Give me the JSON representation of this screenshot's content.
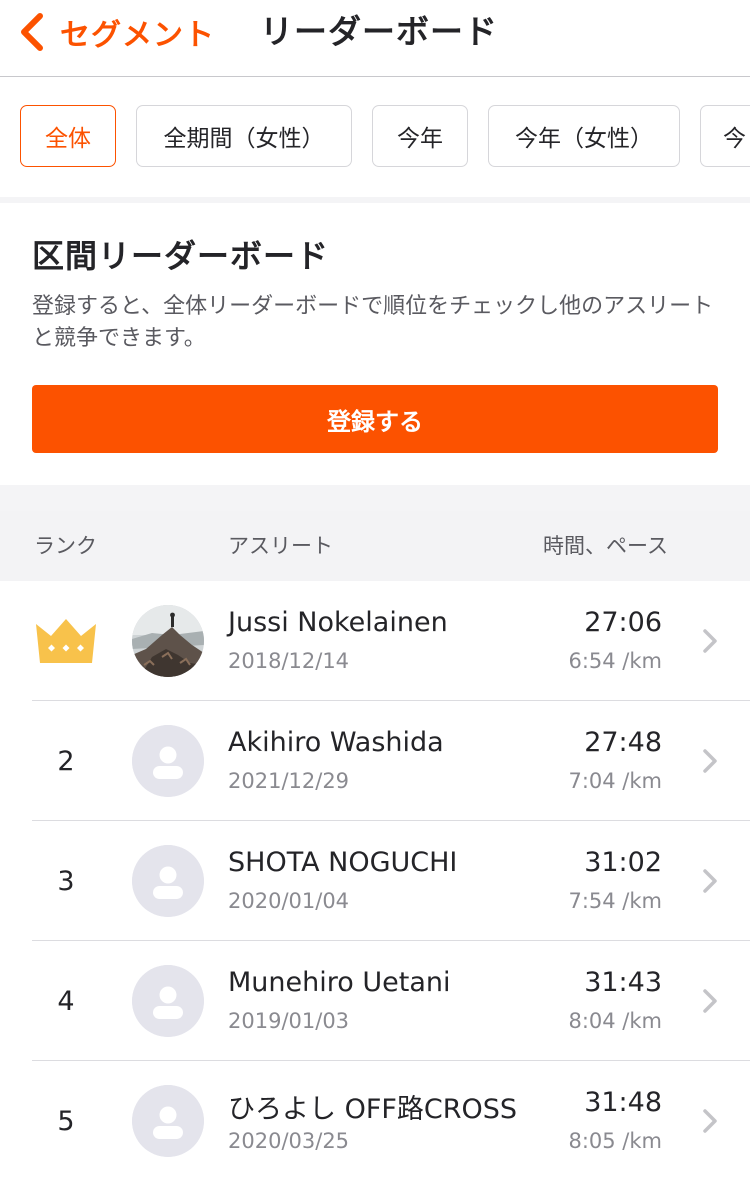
{
  "nav": {
    "back_label": "セグメント",
    "title": "リーダーボード"
  },
  "filters": [
    {
      "label": "全体",
      "active": true
    },
    {
      "label": "全期間（女性）",
      "active": false
    },
    {
      "label": "今年",
      "active": false
    },
    {
      "label": "今年（女性）",
      "active": false
    },
    {
      "label": "今",
      "active": false
    }
  ],
  "card": {
    "title": "区間リーダーボード",
    "description": "登録すると、全体リーダーボードで順位をチェックし他のアスリートと競争できます。",
    "button_label": "登録する"
  },
  "table": {
    "headers": {
      "rank": "ランク",
      "athlete": "アスリート",
      "time": "時間、ペース"
    },
    "rows": [
      {
        "rank": "1",
        "rank_icon": "crown-icon",
        "avatar": "photo",
        "name": "Jussi Nokelainen",
        "date": "2018/12/14",
        "time": "27:06",
        "pace": "6:54 /km"
      },
      {
        "rank": "2",
        "avatar": "default",
        "name": "Akihiro Washida",
        "date": "2021/12/29",
        "time": "27:48",
        "pace": "7:04 /km"
      },
      {
        "rank": "3",
        "avatar": "default",
        "name": "SHOTA NOGUCHI",
        "date": "2020/01/04",
        "time": "31:02",
        "pace": "7:54 /km"
      },
      {
        "rank": "4",
        "avatar": "default",
        "name": "Munehiro Uetani",
        "date": "2019/01/03",
        "time": "31:43",
        "pace": "8:04 /km"
      },
      {
        "rank": "5",
        "avatar": "default",
        "name": "ひろよし OFF路CROSS",
        "date": "2020/03/25",
        "time": "31:48",
        "pace": "8:05 /km"
      }
    ]
  },
  "colors": {
    "accent": "#fc5200",
    "crown": "#f8c24b",
    "avatar_bg": "#e4e4ec"
  }
}
